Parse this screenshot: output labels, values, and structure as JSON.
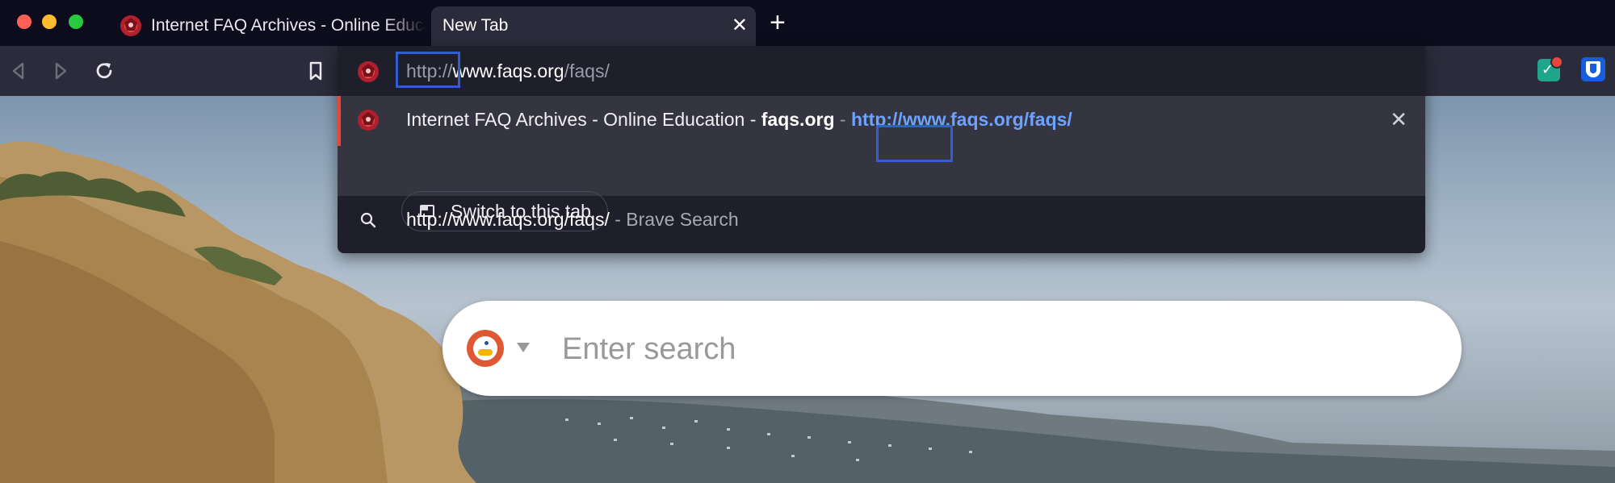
{
  "tabs": [
    {
      "title": "Internet FAQ Archives - Online Education - faqs.org",
      "active": false
    },
    {
      "title": "New Tab",
      "active": true
    }
  ],
  "new_tab_label": "+",
  "close_glyph": "✕",
  "omnibox": {
    "url_prefix": "http://",
    "url_host": "www.faqs.org",
    "url_path": "/faqs/",
    "selected_suggestion": {
      "title": "Internet FAQ Archives - Online Education - ",
      "domain": "faqs.org",
      "separator": " - ",
      "url_prefix": "http://",
      "url_rest": "www.faqs.org/faqs/"
    },
    "switch_tab_label": "Switch to this tab",
    "search_suggestion": {
      "query": "http://www.faqs.org/faqs/",
      "engine_suffix": " - Brave Search"
    }
  },
  "search_box": {
    "placeholder": "Enter search"
  },
  "icons": {
    "back": "back-arrow-icon",
    "forward": "forward-arrow-icon",
    "reload": "reload-icon",
    "bookmark": "bookmark-icon",
    "extension1": "extension-check-icon",
    "extension2": "bitwarden-shield-icon"
  },
  "colors": {
    "tabbar": "#0d0c1c",
    "toolbar": "#2b2b3b",
    "omnibox": "#1f1f2b",
    "selected_row": "#353541",
    "accent_red": "#e8453c",
    "link_blue": "#6ea2ff",
    "highlight_box": "#2f5fd0"
  }
}
